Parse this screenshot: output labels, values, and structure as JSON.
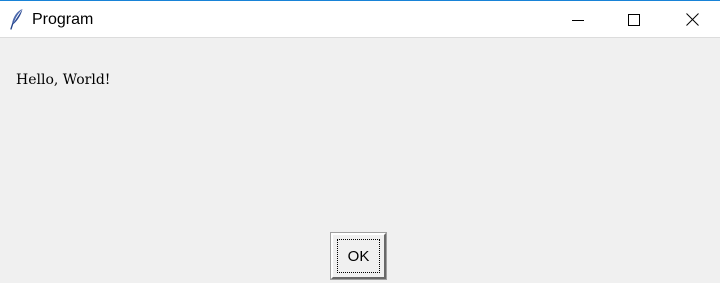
{
  "window": {
    "title": "Program",
    "icon": "feather-icon",
    "controls": {
      "minimize_icon": "minimize-icon",
      "maximize_icon": "maximize-icon",
      "close_icon": "close-icon"
    }
  },
  "content": {
    "message": "Hello, World!",
    "ok_label": "OK"
  },
  "colors": {
    "titlebar_bg": "#ffffff",
    "window_bg": "#f0f0f0",
    "accent_border": "#1883d7"
  }
}
